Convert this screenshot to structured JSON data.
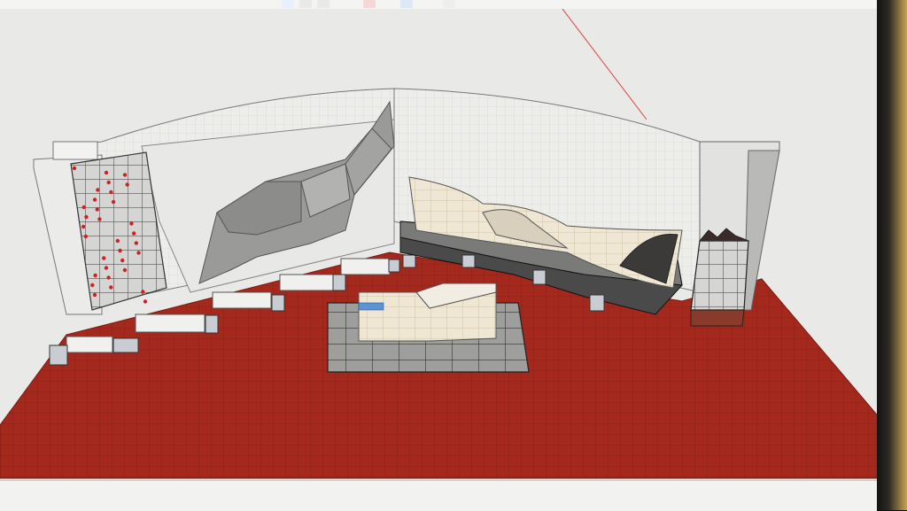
{
  "app": {
    "toolbar": {
      "icons": [
        {
          "name": "select-tool-icon",
          "color": "#e7f0fb"
        },
        {
          "name": "eraser-tool-icon",
          "color": "#e9e9e9"
        },
        {
          "name": "pencil-tool-icon",
          "color": "#e9e9e9"
        },
        {
          "name": "paint-bucket-icon",
          "color": "#f5d7d7"
        },
        {
          "name": "push-pull-icon",
          "color": "#dde8f6"
        },
        {
          "name": "orbit-icon",
          "color": "#eeeeee"
        }
      ]
    },
    "viewport": {
      "background": "#e9e9e7",
      "floor_color": "#a5281c",
      "floor_grid_color": "#8f2116",
      "wall_color": "#e4e4e2",
      "volume_color": "#9a9a98",
      "platform_color": "#5f5f5f",
      "hold_color": "#cc2222",
      "panel_color": "#efe6d3"
    },
    "statusbar": {
      "text": ""
    }
  }
}
